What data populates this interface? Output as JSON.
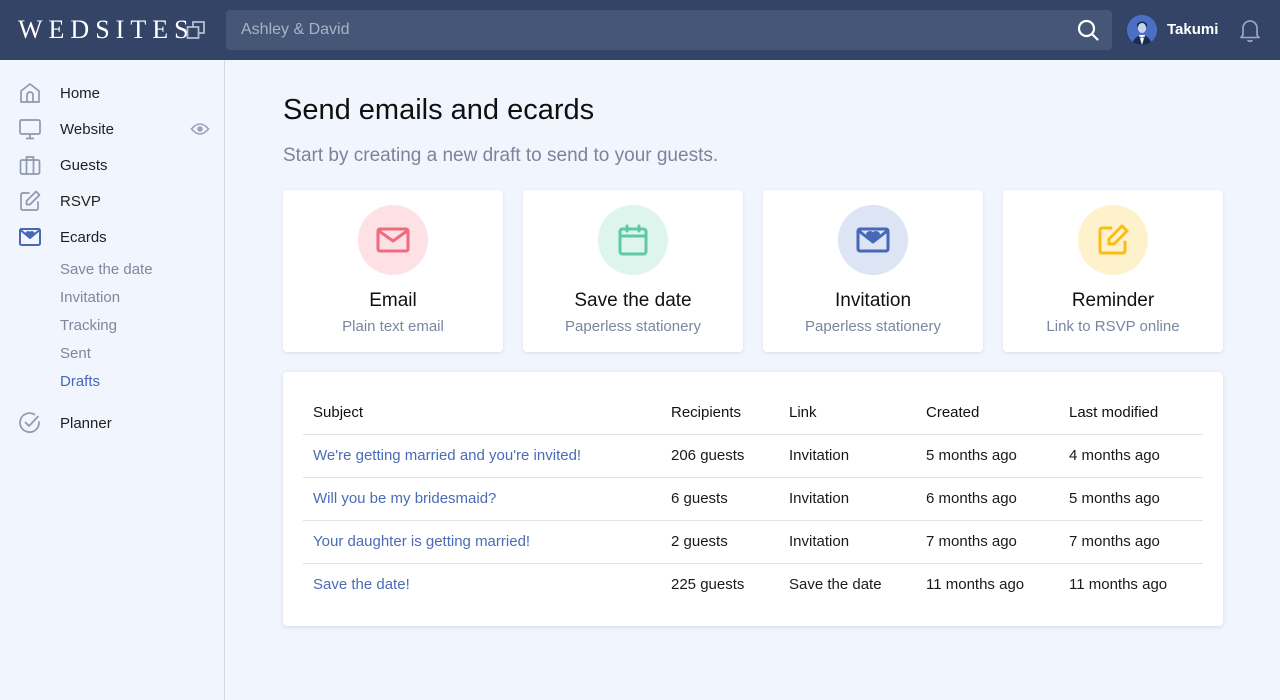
{
  "header": {
    "logo": "WEDSITES",
    "search_value": "",
    "search_placeholder": "Ashley & David",
    "user_name": "Takumi",
    "icons": [
      "switch-site-icon",
      "search-icon",
      "avatar",
      "bell-icon"
    ]
  },
  "sidebar": {
    "items": [
      {
        "label": "Home",
        "icon": "home-icon"
      },
      {
        "label": "Website",
        "icon": "monitor-icon",
        "extra_icon": "eye-icon"
      },
      {
        "label": "Guests",
        "icon": "briefcase-icon"
      },
      {
        "label": "RSVP",
        "icon": "edit-icon"
      },
      {
        "label": "Ecards",
        "icon": "heart-envelope-icon",
        "active": true
      },
      {
        "label": "Planner",
        "icon": "check-circle-icon"
      }
    ],
    "ecards_sub": [
      {
        "label": "Save the date"
      },
      {
        "label": "Invitation"
      },
      {
        "label": "Tracking"
      },
      {
        "label": "Sent"
      },
      {
        "label": "Drafts",
        "active": true
      }
    ]
  },
  "main": {
    "title": "Send emails and ecards",
    "subtitle": "Start by creating a new draft to send to your guests.",
    "cards": [
      {
        "title": "Email",
        "subtitle": "Plain text email",
        "icon": "envelope-icon",
        "icon_color": "#f06a80",
        "bg_color": "#fde1e5"
      },
      {
        "title": "Save the date",
        "subtitle": "Paperless stationery",
        "icon": "calendar-icon",
        "icon_color": "#5fc9a4",
        "bg_color": "#def5ee"
      },
      {
        "title": "Invitation",
        "subtitle": "Paperless stationery",
        "icon": "heart-envelope-icon",
        "icon_color": "#4668b9",
        "bg_color": "#dde4f3"
      },
      {
        "title": "Reminder",
        "subtitle": "Link to RSVP online",
        "icon": "edit-icon",
        "icon_color": "#fbbd15",
        "bg_color": "#fef2cc"
      }
    ],
    "table": {
      "headers": [
        "Subject",
        "Recipients",
        "Link",
        "Created",
        "Last modified"
      ],
      "rows": [
        [
          "We're getting married and you're invited!",
          "206 guests",
          "Invitation",
          "5 months ago",
          "4 months ago"
        ],
        [
          "Will you be my bridesmaid?",
          "6 guests",
          "Invitation",
          "6 months ago",
          "5 months ago"
        ],
        [
          "Your daughter is getting married!",
          "2 guests",
          "Invitation",
          "7 months ago",
          "7 months ago"
        ],
        [
          "Save the date!",
          "225 guests",
          "Save the date",
          "11 months ago",
          "11 months ago"
        ]
      ]
    }
  },
  "colors": {
    "topbar": "#344467",
    "accent": "#4668b9",
    "page_bg": "#f1f5fd"
  }
}
